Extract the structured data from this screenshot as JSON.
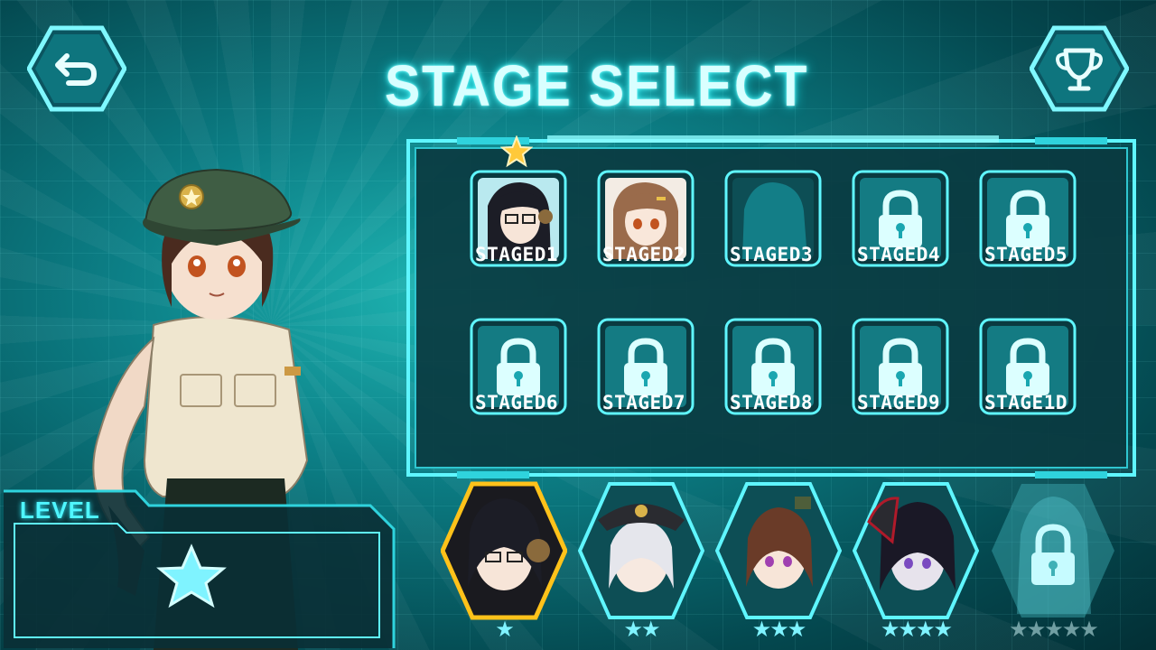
{
  "header": {
    "title": "STAGE SELECT"
  },
  "buttons": {
    "back_icon": "back-arrow-icon",
    "trophy_icon": "trophy-icon"
  },
  "stages": [
    {
      "label": "STAGED1",
      "state": "unlocked-portrait",
      "starred": true
    },
    {
      "label": "STAGED2",
      "state": "unlocked-portrait",
      "starred": false
    },
    {
      "label": "STAGED3",
      "state": "silhouette",
      "starred": false
    },
    {
      "label": "STAGED4",
      "state": "locked",
      "starred": false
    },
    {
      "label": "STAGED5",
      "state": "locked",
      "starred": false
    },
    {
      "label": "STAGED6",
      "state": "locked",
      "starred": false
    },
    {
      "label": "STAGED7",
      "state": "locked",
      "starred": false
    },
    {
      "label": "STAGED8",
      "state": "locked",
      "starred": false
    },
    {
      "label": "STAGED9",
      "state": "locked",
      "starred": false
    },
    {
      "label": "STAGE1D",
      "state": "locked",
      "starred": false
    }
  ],
  "level": {
    "label": "LEVEL",
    "icon": "star-icon"
  },
  "characters": [
    {
      "stars": 1,
      "selected": true,
      "locked": false
    },
    {
      "stars": 2,
      "selected": false,
      "locked": false
    },
    {
      "stars": 3,
      "selected": false,
      "locked": false
    },
    {
      "stars": 4,
      "selected": false,
      "locked": false
    },
    {
      "stars": 5,
      "selected": false,
      "locked": true
    }
  ],
  "colors": {
    "accent": "#4ff6ff",
    "panel_bg": "#0a3a40",
    "selected": "#ffc21a",
    "star": "#7ff3ff"
  }
}
